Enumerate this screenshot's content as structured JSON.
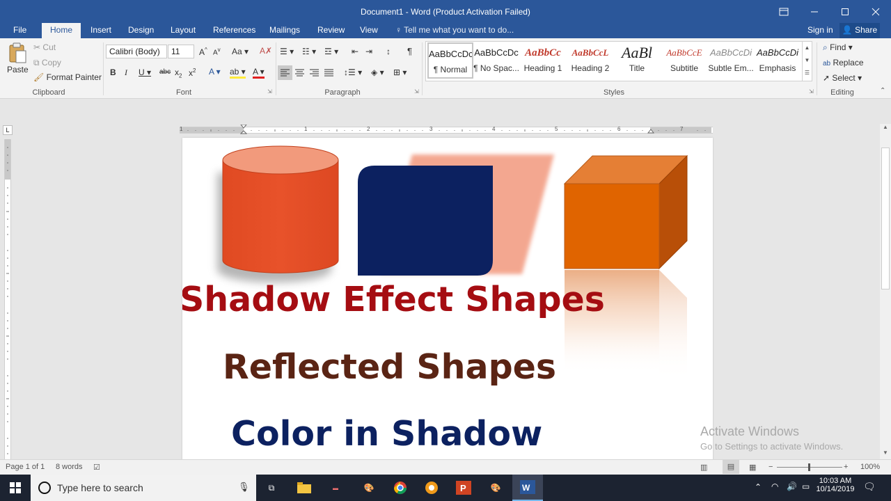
{
  "window": {
    "title": "Document1 - Word (Product Activation Failed)"
  },
  "tabs": [
    {
      "label": "File"
    },
    {
      "label": "Home"
    },
    {
      "label": "Insert"
    },
    {
      "label": "Design"
    },
    {
      "label": "Layout"
    },
    {
      "label": "References"
    },
    {
      "label": "Mailings"
    },
    {
      "label": "Review"
    },
    {
      "label": "View"
    }
  ],
  "tell_me": "Tell me what you want to do...",
  "sign_in": "Sign in",
  "share": "Share",
  "clipboard": {
    "paste": "Paste",
    "cut": "Cut",
    "copy": "Copy",
    "format_painter": "Format Painter",
    "label": "Clipboard"
  },
  "font": {
    "name": "Calibri (Body)",
    "size": "11",
    "label": "Font"
  },
  "paragraph": {
    "label": "Paragraph"
  },
  "styles": {
    "label": "Styles",
    "items": [
      {
        "sample": "AaBbCcDc",
        "name": "¶ Normal"
      },
      {
        "sample": "AaBbCcDc",
        "name": "¶ No Spac..."
      },
      {
        "sample": "AaBbCc",
        "name": "Heading 1"
      },
      {
        "sample": "AaBbCcL",
        "name": "Heading 2"
      },
      {
        "sample": "AaBl",
        "name": "Title"
      },
      {
        "sample": "AaBbCcE",
        "name": "Subtitle"
      },
      {
        "sample": "AaBbCcDi",
        "name": "Subtle Em..."
      },
      {
        "sample": "AaBbCcDi",
        "name": "Emphasis"
      }
    ]
  },
  "editing": {
    "find": "Find",
    "replace": "Replace",
    "select": "Select",
    "label": "Editing"
  },
  "ruler_numbers": [
    "1",
    "1",
    "2",
    "3",
    "4",
    "5",
    "6",
    "7"
  ],
  "document": {
    "heading1": "Shadow Effect Shapes",
    "heading2": "Reflected Shapes",
    "heading3": "Color in Shadow",
    "colors": {
      "heading1": "#a50d12",
      "heading2": "#5a2414",
      "heading3": "#0c2160"
    }
  },
  "watermark": {
    "line1": "Activate Windows",
    "line2": "Go to Settings to activate Windows."
  },
  "status": {
    "page": "Page 1 of 1",
    "words": "8 words",
    "zoom": "100%"
  },
  "taskbar": {
    "search_placeholder": "Type here to search",
    "time": "10:03 AM",
    "date": "10/14/2019"
  }
}
